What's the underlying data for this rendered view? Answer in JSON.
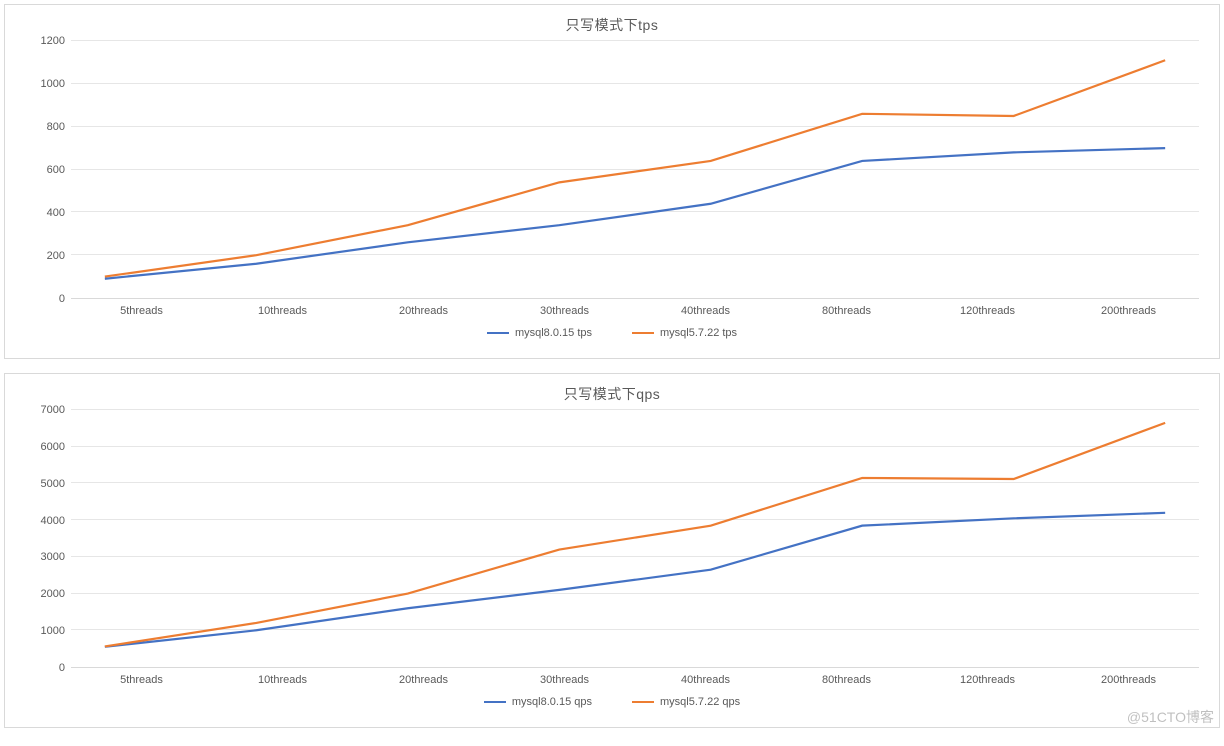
{
  "watermark": "@51CTO博客",
  "colors": {
    "series1": "#4472C4",
    "series2": "#ED7D31"
  },
  "chart_data": [
    {
      "type": "line",
      "title": "只写模式下tps",
      "xlabel": "",
      "ylabel": "",
      "categories": [
        "5threads",
        "10threads",
        "20threads",
        "30threads",
        "40threads",
        "80threads",
        "120threads",
        "200threads"
      ],
      "series": [
        {
          "name": "mysql8.0.15 tps",
          "values": [
            90,
            160,
            260,
            340,
            440,
            640,
            680,
            700
          ]
        },
        {
          "name": "mysql5.7.22 tps",
          "values": [
            100,
            200,
            340,
            540,
            640,
            860,
            850,
            1110
          ]
        }
      ],
      "y_ticks": [
        0,
        200,
        400,
        600,
        800,
        1000,
        1200
      ],
      "ylim": [
        0,
        1200
      ]
    },
    {
      "type": "line",
      "title": "只写模式下qps",
      "xlabel": "",
      "ylabel": "",
      "categories": [
        "5threads",
        "10threads",
        "20threads",
        "30threads",
        "40threads",
        "80threads",
        "120threads",
        "200threads"
      ],
      "series": [
        {
          "name": "mysql8.0.15 qps",
          "values": [
            550,
            1000,
            1600,
            2100,
            2650,
            3850,
            4050,
            4200
          ]
        },
        {
          "name": "mysql5.7.22 qps",
          "values": [
            560,
            1200,
            2000,
            3200,
            3850,
            5150,
            5120,
            6650
          ]
        }
      ],
      "y_ticks": [
        0,
        1000,
        2000,
        3000,
        4000,
        5000,
        6000,
        7000
      ],
      "ylim": [
        0,
        7000
      ]
    }
  ]
}
